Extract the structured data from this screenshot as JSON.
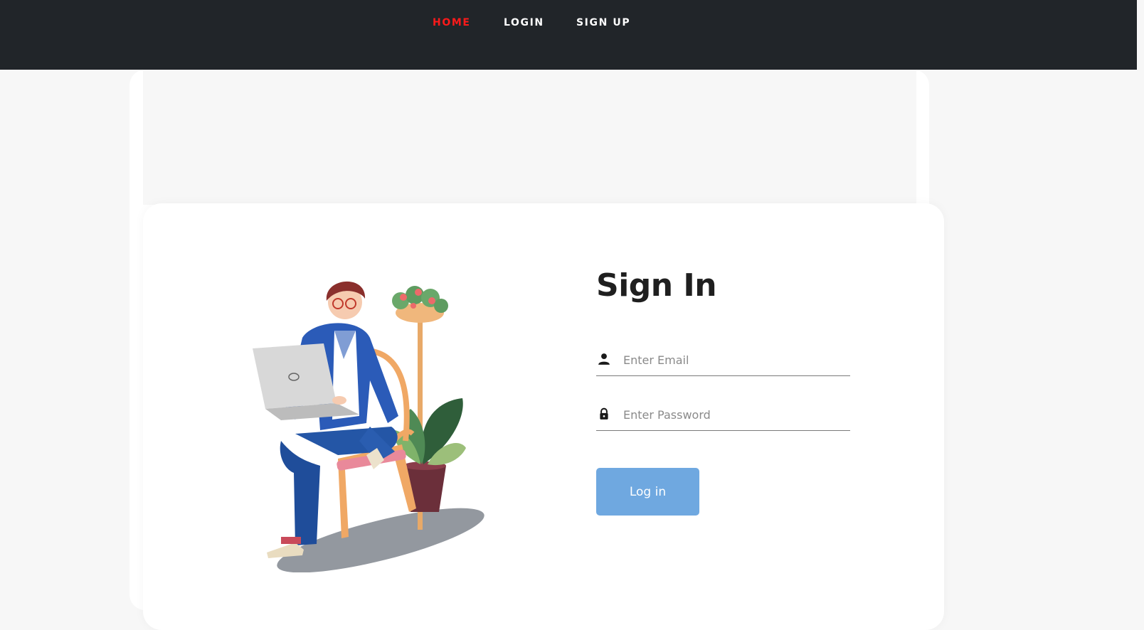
{
  "nav": {
    "home": "HOME",
    "login": "LOGIN",
    "signup": "SIGN UP"
  },
  "signin": {
    "title": "Sign In",
    "email_placeholder": "Enter Email",
    "password_placeholder": "Enter Password",
    "button_label": "Log in"
  },
  "colors": {
    "nav_bg": "#212529",
    "nav_active": "#ff1a1a",
    "button_bg": "#6fa8e0",
    "page_bg": "#f7f7f7"
  },
  "icons": {
    "email": "user-icon",
    "password": "lock-icon"
  }
}
